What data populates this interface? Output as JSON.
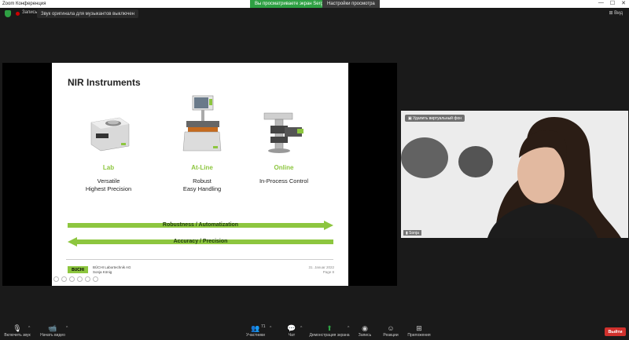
{
  "window": {
    "title": "Zoom Конференция",
    "controls": [
      "—",
      "☐",
      "✕"
    ]
  },
  "banners": {
    "sharing": "Вы просматриваете экран Sergei",
    "settings": "Настройки просмотра"
  },
  "topbar": {
    "recording_label": "Запись",
    "notice": "Звук оригинала для музыкантов выключен",
    "view_label": "Вид"
  },
  "slide": {
    "title": "NIR Instruments",
    "instruments": [
      {
        "category": "Lab",
        "desc1": "Versatile",
        "desc2": "Highest Precision"
      },
      {
        "category": "At-Line",
        "desc1": "Robust",
        "desc2": "Easy Handling"
      },
      {
        "category": "Online",
        "desc1": "In-Process Control",
        "desc2": ""
      }
    ],
    "arrow_right": "Robustness / Automatization",
    "arrow_left": "Accuracy / Precision",
    "logo": "BUCHI",
    "company1": "BÜCHI Labortechnik AG",
    "company2": "Sonja König",
    "date1": "31. Januar 2022",
    "date2": "Page 8"
  },
  "camera": {
    "remove_bg": "Удалить виртуальный фон",
    "name": "Sonja"
  },
  "bottom": {
    "mute_label": "Включить звук",
    "video_label": "Начать видео",
    "participants_label": "Участники",
    "participants_count": "71",
    "chat_label": "Чат",
    "share_label": "Демонстрация экрана",
    "record_label": "Запись",
    "reactions_label": "Реакции",
    "apps_label": "Приложения",
    "end_label": "Выйти"
  },
  "colors": {
    "accent_green": "#8dc63f",
    "zoom_green": "#2ea043",
    "end_red": "#d0312d"
  }
}
